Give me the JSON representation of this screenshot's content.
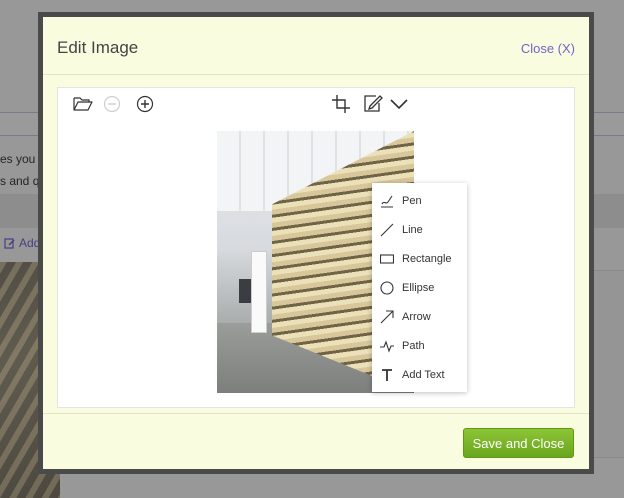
{
  "background": {
    "text_line1": "es you w",
    "text_line2": "s and q",
    "add_label": "Add"
  },
  "dialog": {
    "title": "Edit Image",
    "close_label": "Close (X)"
  },
  "toolbar": {
    "open_icon": "folder-open-icon",
    "zoom_out_icon": "zoom-out-icon",
    "zoom_in_icon": "zoom-in-icon",
    "crop_icon": "crop-icon",
    "draw_icon": "draw-icon",
    "dropdown_icon": "chevron-down-icon"
  },
  "draw_menu": {
    "items": [
      {
        "label": "Pen",
        "icon": "pen-icon"
      },
      {
        "label": "Line",
        "icon": "line-icon"
      },
      {
        "label": "Rectangle",
        "icon": "rectangle-icon"
      },
      {
        "label": "Ellipse",
        "icon": "ellipse-icon"
      },
      {
        "label": "Arrow",
        "icon": "arrow-icon"
      },
      {
        "label": "Path",
        "icon": "path-icon"
      },
      {
        "label": "Add Text",
        "icon": "text-icon"
      }
    ]
  },
  "footer": {
    "save_label": "Save and Close"
  },
  "colors": {
    "dialog_bg": "#fafcdf",
    "link": "#6f63cf",
    "save_button": "#7ab42a"
  }
}
